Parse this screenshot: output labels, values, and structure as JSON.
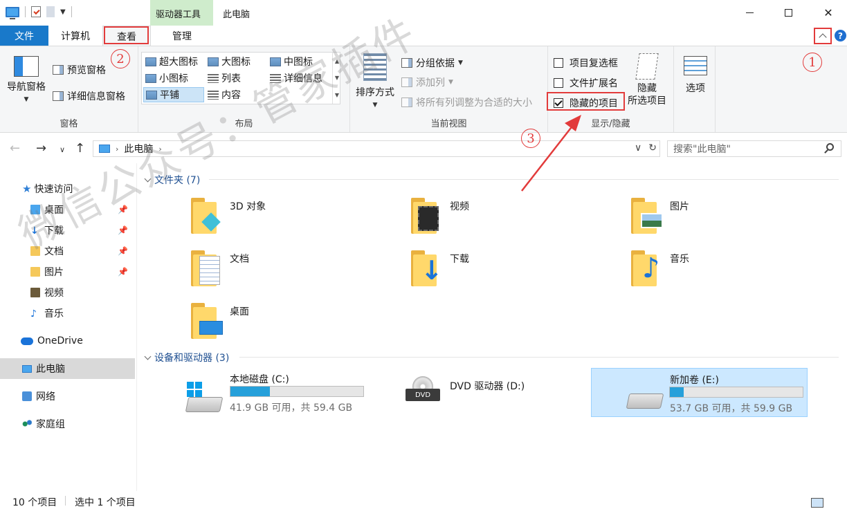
{
  "window": {
    "title": "此电脑",
    "context_tab": "驱动器工具"
  },
  "tabs": [
    "文件",
    "计算机",
    "查看",
    "管理"
  ],
  "ribbon": {
    "pane": {
      "nav_pane": "导航窗格",
      "preview_pane": "预览窗格",
      "details_pane": "详细信息窗格",
      "label": "窗格"
    },
    "layout": {
      "items": [
        "超大图标",
        "大图标",
        "中图标",
        "小图标",
        "列表",
        "详细信息",
        "平铺",
        "内容"
      ],
      "selected": "平铺",
      "label": "布局"
    },
    "current_view": {
      "sort": "排序方式",
      "group_by": "分组依据",
      "add_column": "添加列",
      "fit_columns": "将所有列调整为合适的大小",
      "label": "当前视图"
    },
    "show_hide": {
      "item_checkboxes": "项目复选框",
      "file_extensions": "文件扩展名",
      "hidden_items": "隐藏的项目",
      "hidden_items_checked": true,
      "hide_selected_1": "隐藏",
      "hide_selected_2": "所选项目",
      "label": "显示/隐藏"
    },
    "options": "选项"
  },
  "address": {
    "path": "此电脑",
    "search_placeholder": "搜索\"此电脑\""
  },
  "sidebar": {
    "quick_access": "快速访问",
    "items": [
      "桌面",
      "下载",
      "文档",
      "图片",
      "视频",
      "音乐"
    ],
    "onedrive": "OneDrive",
    "this_pc": "此电脑",
    "network": "网络",
    "homegroup": "家庭组"
  },
  "content": {
    "folders_header": "文件夹 (7)",
    "folders": [
      "3D 对象",
      "视频",
      "图片",
      "文档",
      "下载",
      "音乐",
      "桌面"
    ],
    "devices_header": "设备和驱动器 (3)",
    "drives": [
      {
        "name": "本地磁盘 (C:)",
        "free": "41.9 GB 可用，共 59.4 GB",
        "used_fraction": 0.295
      },
      {
        "name": "DVD 驱动器 (D:)"
      },
      {
        "name": "新加卷 (E:)",
        "free": "53.7 GB 可用，共 59.9 GB",
        "used_fraction": 0.104
      }
    ],
    "drive_icon_text": "DVD"
  },
  "status": {
    "count": "10 个项目",
    "selected": "选中 1 个项目"
  },
  "annotations": {
    "n1": "1",
    "n2": "2",
    "n3": "3",
    "watermark": "微信公众号：管家插件"
  },
  "colors": {
    "accent": "#1979ca",
    "highlight_red": "#e23b3b",
    "drive_fill": "#26a0da",
    "context_tab_bg": "#cfeccc"
  }
}
